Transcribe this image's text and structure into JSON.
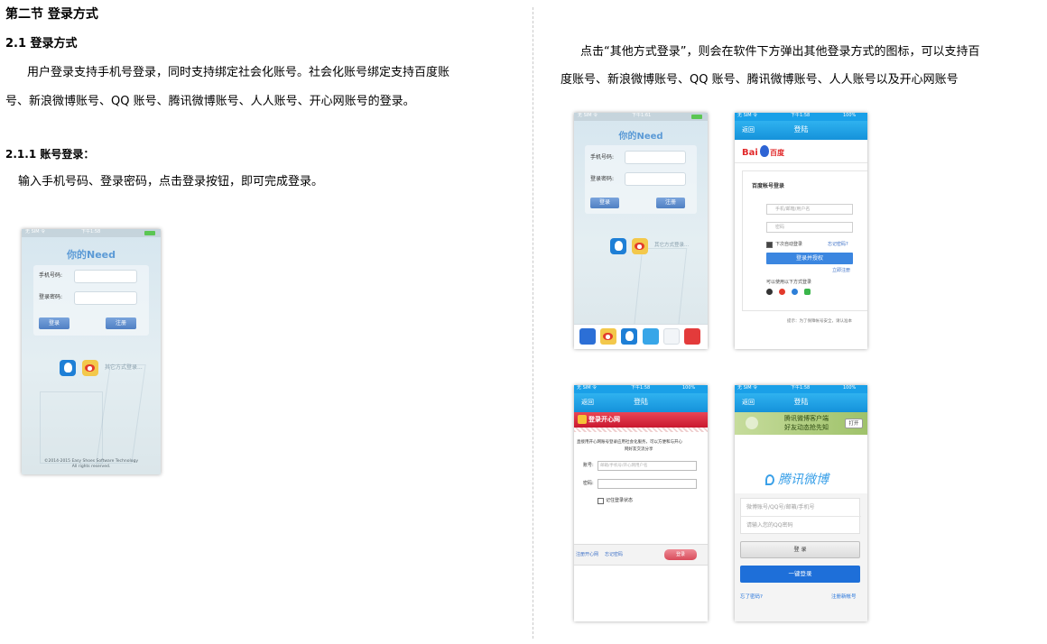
{
  "doc": {
    "section_title": "第二节  登录方式",
    "sub_title": "2.1  登录方式",
    "para1_line1": "用户登录支持手机号登录，同时支持绑定社会化账号。社会化账号绑定支持百度账",
    "para1_line2": "号、新浪微博账号、QQ 账号、腾讯微博账号、人人账号、开心网账号的登录。",
    "sub_sub_title": "2.1.1  账号登录：",
    "para2": "输入手机号码、登录密码，点击登录按钮，即可完成登录。",
    "para3_line1": "点击“其他方式登录”，则会在软件下方弹出其他登录方式的图标，可以支持百",
    "para3_line2": "度账号、新浪微博账号、QQ 账号、腾讯微博账号、人人账号以及开心网账号"
  },
  "app_login": {
    "title": "你的Need",
    "phone_label": "手机号码:",
    "password_label": "登录密码:",
    "login_button": "登录",
    "register_button": "注册",
    "other_login": "其它方式登录...",
    "copyright_line1": "©2014-2015 Easy Shoes Software Technology",
    "copyright_line2": "All rights reserved."
  },
  "status_bar": {
    "carrier": "无 SIM 令",
    "time": "下午1:58",
    "battery": "100%"
  },
  "status_bar_small": {
    "time": "下午1:61"
  },
  "nav": {
    "back": "返回",
    "title": "登陆"
  },
  "baidu": {
    "logo_bai": "Bai",
    "logo_du": "百度",
    "heading": "百度帐号登录",
    "username_placeholder": "手机/邮箱/用户名",
    "password_placeholder": "密码",
    "remember": "下次自动登录",
    "forgot": "忘记密码?",
    "submit": "登录并授权",
    "register": "立即注册",
    "other_accounts": "可以使用以下方式登录",
    "tip": "提示：为了保障帐号安全，请认准本"
  },
  "kaixin": {
    "banner": "登录开心网",
    "intro_line1": "直接用开心网账号登录应用社会化服务，可以方便和与开心",
    "intro_line2": "网好友交流分享",
    "account_label": "账号:",
    "account_placeholder": "邮箱/手机号/开心网用户名",
    "password_label": "密码:",
    "remember": "记住登录状态",
    "register_link": "注册开心网",
    "forgot_link": "忘记密码",
    "submit": "登录"
  },
  "tencent": {
    "ad_line1": "腾讯微博客户端",
    "ad_line2": "好友动态抢先知",
    "ad_open": "打开",
    "logo": "腾讯微博",
    "account_placeholder": "微博账号/QQ号/邮箱/手机号",
    "password_placeholder": "请输入您的QQ密码",
    "login": "登 录",
    "one_click": "一键登录",
    "forgot": "忘了密码?",
    "register": "注册新帐号"
  },
  "colors": {
    "nav_blue": "#1592da",
    "button_blue": "#5583c6",
    "baidu_blue": "#3b86e0",
    "kaixin_red": "#d9233a",
    "tencent_blue": "#1e6fd9"
  }
}
